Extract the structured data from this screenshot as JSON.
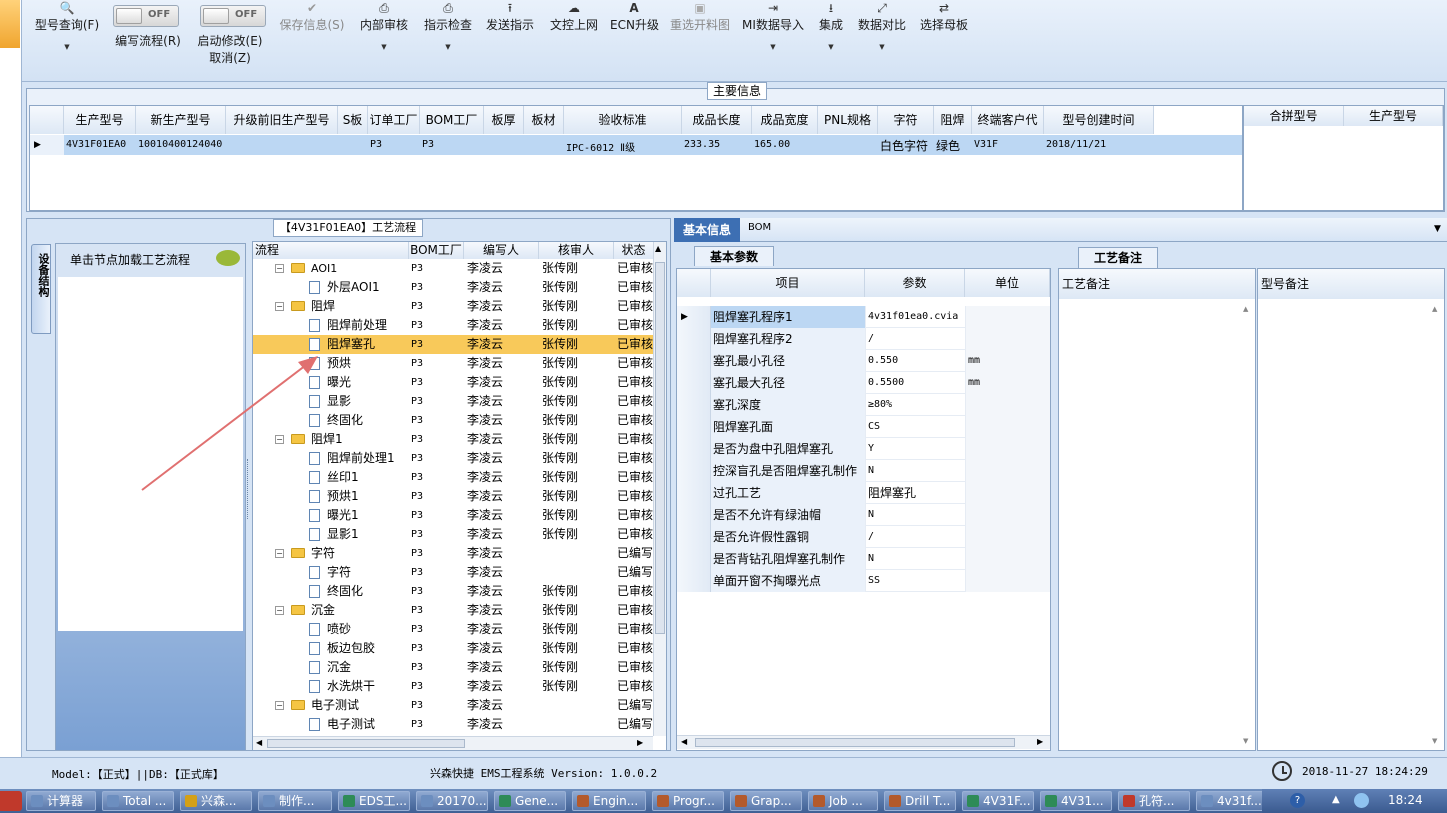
{
  "toolbar": {
    "query": "型号查询(F)",
    "write_flow": "编写流程(R)",
    "start_modify": "启动修改(E)",
    "cancel": "取消(Z)",
    "toggle_off": "OFF",
    "save": "保存信息(S)",
    "internal_review": "内部审核",
    "inspect": "指示检查",
    "send": "发送指示",
    "upload": "文控上网",
    "ecn": "ECN升级",
    "reselect": "重选开料图",
    "mi_import": "MI数据导入",
    "integrate": "集成",
    "compare": "数据对比",
    "select_parent": "选择母板"
  },
  "main_info": {
    "title": "主要信息",
    "columns": [
      "生产型号",
      "新生产型号",
      "升级前旧生产型号",
      "S板",
      "订单工厂",
      "BOM工厂",
      "板厚",
      "板材",
      "验收标准",
      "成品长度",
      "成品宽度",
      "PNL规格",
      "字符",
      "阻焊",
      "终端客户代码",
      "型号创建时间"
    ],
    "row": [
      "4V31F01EA0",
      "10010400124040",
      "",
      "",
      "P3",
      "P3",
      "",
      "",
      "IPC-6012 Ⅱ级",
      "233.35",
      "165.00",
      "",
      "白色字符",
      "绿色",
      "V31F",
      "2018/11/21"
    ],
    "merge_columns": [
      "合拼型号",
      "生产型号"
    ]
  },
  "flow": {
    "title": "【4V31F01EA0】工艺流程",
    "side_tab": "设备结构",
    "hint": "单击节点加载工艺流程",
    "columns": [
      "流程",
      "BOM工厂",
      "编写人",
      "核审人",
      "状态"
    ],
    "rows": [
      {
        "name": "AOI1",
        "type": "folder",
        "level": 0,
        "bom": "P3",
        "writer": "李凌云",
        "reviewer": "张传刚",
        "status": "已审核"
      },
      {
        "name": "外层AOI1",
        "type": "doc",
        "level": 1,
        "bom": "P3",
        "writer": "李凌云",
        "reviewer": "张传刚",
        "status": "已审核"
      },
      {
        "name": "阻焊",
        "type": "folder",
        "level": 0,
        "bom": "P3",
        "writer": "李凌云",
        "reviewer": "张传刚",
        "status": "已审核"
      },
      {
        "name": "阻焊前处理",
        "type": "doc",
        "level": 1,
        "bom": "P3",
        "writer": "李凌云",
        "reviewer": "张传刚",
        "status": "已审核"
      },
      {
        "name": "阻焊塞孔",
        "type": "doc",
        "level": 1,
        "bom": "P3",
        "writer": "李凌云",
        "reviewer": "张传刚",
        "status": "已审核"
      },
      {
        "name": "预烘",
        "type": "doc",
        "level": 1,
        "bom": "P3",
        "writer": "李凌云",
        "reviewer": "张传刚",
        "status": "已审核"
      },
      {
        "name": "曝光",
        "type": "doc",
        "level": 1,
        "bom": "P3",
        "writer": "李凌云",
        "reviewer": "张传刚",
        "status": "已审核"
      },
      {
        "name": "显影",
        "type": "doc",
        "level": 1,
        "bom": "P3",
        "writer": "李凌云",
        "reviewer": "张传刚",
        "status": "已审核"
      },
      {
        "name": "终固化",
        "type": "doc",
        "level": 1,
        "bom": "P3",
        "writer": "李凌云",
        "reviewer": "张传刚",
        "status": "已审核"
      },
      {
        "name": "阻焊1",
        "type": "folder",
        "level": 0,
        "bom": "P3",
        "writer": "李凌云",
        "reviewer": "张传刚",
        "status": "已审核"
      },
      {
        "name": "阻焊前处理1",
        "type": "doc",
        "level": 1,
        "bom": "P3",
        "writer": "李凌云",
        "reviewer": "张传刚",
        "status": "已审核"
      },
      {
        "name": "丝印1",
        "type": "doc",
        "level": 1,
        "bom": "P3",
        "writer": "李凌云",
        "reviewer": "张传刚",
        "status": "已审核"
      },
      {
        "name": "预烘1",
        "type": "doc",
        "level": 1,
        "bom": "P3",
        "writer": "李凌云",
        "reviewer": "张传刚",
        "status": "已审核"
      },
      {
        "name": "曝光1",
        "type": "doc",
        "level": 1,
        "bom": "P3",
        "writer": "李凌云",
        "reviewer": "张传刚",
        "status": "已审核"
      },
      {
        "name": "显影1",
        "type": "doc",
        "level": 1,
        "bom": "P3",
        "writer": "李凌云",
        "reviewer": "张传刚",
        "status": "已审核"
      },
      {
        "name": "字符",
        "type": "folder",
        "level": 0,
        "bom": "P3",
        "writer": "李凌云",
        "reviewer": "",
        "status": "已编写"
      },
      {
        "name": "字符",
        "type": "doc",
        "level": 1,
        "bom": "P3",
        "writer": "李凌云",
        "reviewer": "",
        "status": "已编写"
      },
      {
        "name": "终固化",
        "type": "doc",
        "level": 1,
        "bom": "P3",
        "writer": "李凌云",
        "reviewer": "张传刚",
        "status": "已审核"
      },
      {
        "name": "沉金",
        "type": "folder",
        "level": 0,
        "bom": "P3",
        "writer": "李凌云",
        "reviewer": "张传刚",
        "status": "已审核"
      },
      {
        "name": "喷砂",
        "type": "doc",
        "level": 1,
        "bom": "P3",
        "writer": "李凌云",
        "reviewer": "张传刚",
        "status": "已审核"
      },
      {
        "name": "板边包胶",
        "type": "doc",
        "level": 1,
        "bom": "P3",
        "writer": "李凌云",
        "reviewer": "张传刚",
        "status": "已审核"
      },
      {
        "name": "沉金",
        "type": "doc",
        "level": 1,
        "bom": "P3",
        "writer": "李凌云",
        "reviewer": "张传刚",
        "status": "已审核"
      },
      {
        "name": "水洗烘干",
        "type": "doc",
        "level": 1,
        "bom": "P3",
        "writer": "李凌云",
        "reviewer": "张传刚",
        "status": "已审核"
      },
      {
        "name": "电子测试",
        "type": "folder",
        "level": 0,
        "bom": "P3",
        "writer": "李凌云",
        "reviewer": "",
        "status": "已编写"
      },
      {
        "name": "电子测试",
        "type": "doc",
        "level": 1,
        "bom": "P3",
        "writer": "李凌云",
        "reviewer": "",
        "status": "已编写"
      }
    ],
    "selected_index": 4
  },
  "basic": {
    "tabs": [
      "基本信息",
      "BOM"
    ],
    "subtab": "基本参数",
    "columns": [
      "项目",
      "参数",
      "单位"
    ],
    "rows": [
      {
        "item": "阻焊塞孔程序1",
        "value": "4v31f01ea0.cvia",
        "unit": ""
      },
      {
        "item": "阻焊塞孔程序2",
        "value": "/",
        "unit": ""
      },
      {
        "item": "塞孔最小孔径",
        "value": "0.550",
        "unit": "mm"
      },
      {
        "item": "塞孔最大孔径",
        "value": "0.5500",
        "unit": "mm"
      },
      {
        "item": "塞孔深度",
        "value": "≥80%",
        "unit": ""
      },
      {
        "item": "阻焊塞孔面",
        "value": "CS",
        "unit": ""
      },
      {
        "item": "是否为盘中孔阻焊塞孔",
        "value": "Y",
        "unit": ""
      },
      {
        "item": "控深盲孔是否阻焊塞孔制作",
        "value": "N",
        "unit": ""
      },
      {
        "item": "过孔工艺",
        "value": "阻焊塞孔",
        "unit": ""
      },
      {
        "item": "是否不允许有绿油帽",
        "value": "N",
        "unit": ""
      },
      {
        "item": "是否允许假性露铜",
        "value": "/",
        "unit": ""
      },
      {
        "item": "是否背钻孔阻焊塞孔制作",
        "value": "N",
        "unit": ""
      },
      {
        "item": "单面开窗不掏曝光点",
        "value": "SS",
        "unit": ""
      }
    ]
  },
  "notes": {
    "tab": "工艺备注",
    "col1": "工艺备注",
    "col2": "型号备注"
  },
  "status": {
    "model": "Model:【正式】||DB:【正式库】",
    "system": "兴森快捷 EMS工程系统 Version: 1.0.0.2",
    "datetime": "2018-11-27 18:24:29"
  },
  "taskbar": {
    "items": [
      "计算器",
      "Total ...",
      "兴森...",
      "制作...",
      "EDS工...",
      "20170...",
      "Gene...",
      "Engin...",
      "Progr...",
      "Grap...",
      "Job ...",
      "Drill T...",
      "4V31F...",
      "4V31...",
      "孔符...",
      "4v31f..."
    ],
    "clock": "18:24"
  },
  "colors": {
    "accent": "#3d6fb3",
    "selection": "#f8c95a",
    "annotation_arrow": "#e07070"
  }
}
